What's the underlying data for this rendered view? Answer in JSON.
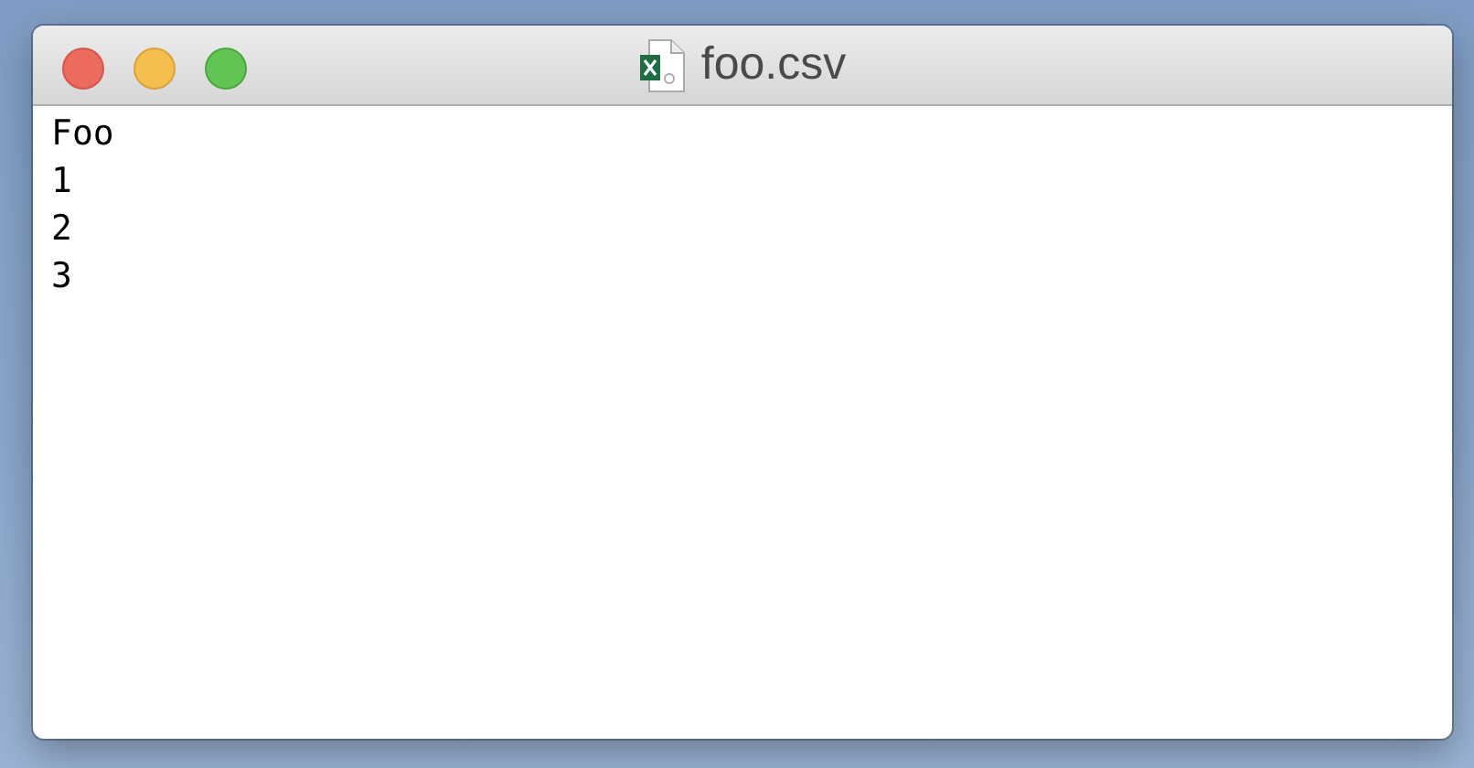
{
  "window": {
    "title": "foo.csv"
  },
  "content": {
    "lines": [
      "Foo",
      "1",
      "2",
      "3"
    ]
  }
}
